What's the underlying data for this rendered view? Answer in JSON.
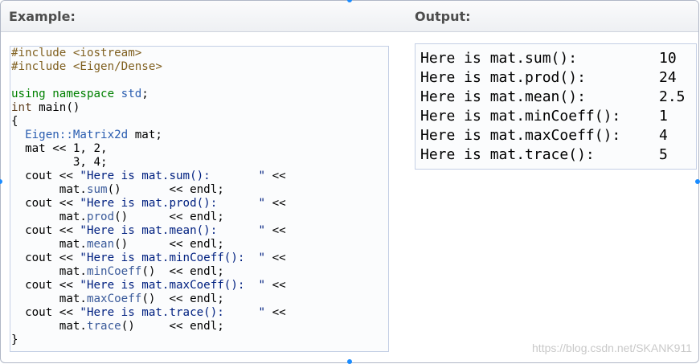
{
  "headers": {
    "example": "Example:",
    "output": "Output:"
  },
  "code": {
    "line1": "#include <iostream>",
    "line2": "#include <Eigen/Dense>",
    "using_kw": "using namespace",
    "using_ns": " std",
    "using_end": ";",
    "int_kw": "int",
    "main_sig": " main()",
    "open_brace": "{",
    "matrix_type": "Eigen::Matrix2d",
    "matrix_decl": " mat;",
    "init1": "  mat << 1, 2,",
    "init2": "         3, 4;",
    "cout_prefix": "  cout << ",
    "cout_suffix": " <<",
    "mat_prefix": "       mat.",
    "close_brace": "}",
    "statements": [
      {
        "str": "\"Here is mat.sum():       \"",
        "fn": "sum",
        "tail": "()       << endl;"
      },
      {
        "str": "\"Here is mat.prod():      \"",
        "fn": "prod",
        "tail": "()      << endl;"
      },
      {
        "str": "\"Here is mat.mean():      \"",
        "fn": "mean",
        "tail": "()      << endl;"
      },
      {
        "str": "\"Here is mat.minCoeff():  \"",
        "fn": "minCoeff",
        "tail": "()  << endl;"
      },
      {
        "str": "\"Here is mat.maxCoeff():  \"",
        "fn": "maxCoeff",
        "tail": "()  << endl;"
      },
      {
        "str": "\"Here is mat.trace():     \"",
        "fn": "trace",
        "tail": "()     << endl;"
      }
    ]
  },
  "output_rows": [
    {
      "label": "Here is mat.sum():",
      "value": "10"
    },
    {
      "label": "Here is mat.prod():",
      "value": "24"
    },
    {
      "label": "Here is mat.mean():",
      "value": "2.5"
    },
    {
      "label": "Here is mat.minCoeff():",
      "value": "1"
    },
    {
      "label": "Here is mat.maxCoeff():",
      "value": "4"
    },
    {
      "label": "Here is mat.trace():",
      "value": "5"
    }
  ],
  "watermark": "https://blog.csdn.net/SKANK911"
}
